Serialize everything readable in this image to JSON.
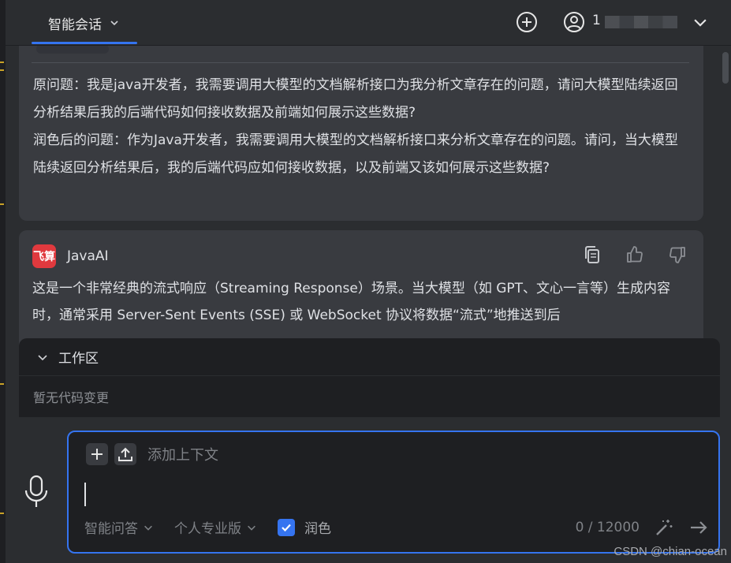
{
  "header": {
    "tab_label": "智能会话",
    "user_id_prefix": "1"
  },
  "conversation": {
    "question_lines": [
      "原问题：我是java开发者，我需要调用大模型的文档解析接口为我分析文章存在的问题，请问大模型陆续返回分析结果后我的后端代码如何接收数据及前端如何展示这些数据?",
      "润色后的问题：作为Java开发者，我需要调用大模型的文档解析接口来分析文章存在的问题。请问，当大模型陆续返回分析结果后，我的后端代码应如何接收数据，以及前端又该如何展示这些数据?"
    ],
    "bot": {
      "logo_text": "飞算",
      "name": "JavaAI",
      "answer": "这是一个非常经典的流式响应（Streaming Response）场景。当大模型（如 GPT、文心一言等）生成内容时，通常采用 Server-Sent Events (SSE) 或 WebSocket 协议将数据“流式”地推送到后"
    }
  },
  "workspace": {
    "title": "工作区",
    "empty_text": "暂无代码变更"
  },
  "input": {
    "context_placeholder": "添加上下文",
    "mode_select": "智能问答",
    "edition_select": "个人专业版",
    "polish_label": "润色",
    "polish_checked": true,
    "counter": "0 / 12000"
  },
  "watermark": "CSDN @chian-ocean",
  "colors": {
    "accent": "#3574f0",
    "background": "#2b2d30",
    "card": "#393b40",
    "logo": "#e0393e"
  },
  "icons": [
    "chevron-down-icon",
    "plus-circle-icon",
    "user-icon",
    "copy-icon",
    "thumbs-up-icon",
    "thumbs-down-icon",
    "plus-icon",
    "upload-icon",
    "microphone-icon",
    "magic-wand-icon",
    "send-arrow-icon"
  ]
}
